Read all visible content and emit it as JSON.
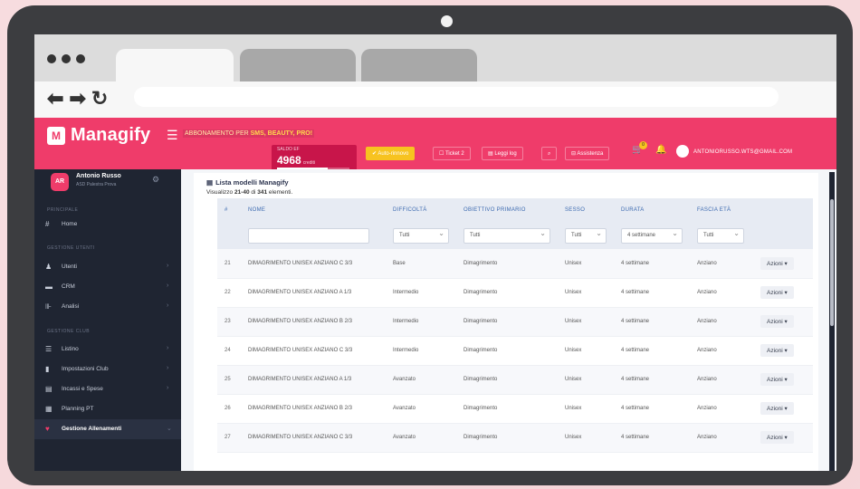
{
  "app": {
    "logo_text": "Managify",
    "marquee_prefix": "ABBONAMENTO PER ",
    "marquee_highlight": "SMS, BEAUTY, PRO!",
    "saldo_label": "SALDO EF",
    "saldo_value": "4968",
    "saldo_unit": "crediti",
    "saldo_fraction": 0.7,
    "btn_yellow": "✔ Auto-rinnovo",
    "btn_ticket": "☐ Ticket 2",
    "btn_leggi": "▤ Leggi log",
    "btn_search": "⌕",
    "btn_assistenza": "⊟ Assistenza",
    "cart_badge": "0",
    "user_email": "ANTONIORUSSO.WTS@GMAIL.COM"
  },
  "sidebar": {
    "profile_initials": "AR",
    "profile_name": "Antonio Russo",
    "profile_sub": "ASD Palestra Prova",
    "sections": [
      {
        "heading": "PRINCIPALE"
      },
      {
        "heading": "GESTIONE UTENTI"
      },
      {
        "heading": "GESTIONE CLUB"
      }
    ],
    "items": [
      {
        "label": "Home",
        "icon": "#"
      },
      {
        "label": "Utenti",
        "icon": "♟"
      },
      {
        "label": "CRM",
        "icon": "▬"
      },
      {
        "label": "Analisi",
        "icon": "⊪"
      },
      {
        "label": "Listino",
        "icon": "☰"
      },
      {
        "label": "Impostazioni Club",
        "icon": "▮"
      },
      {
        "label": "Incassi e Spese",
        "icon": "▤"
      },
      {
        "label": "Planning PT",
        "icon": "▦"
      },
      {
        "label": "Gestione Allenamenti",
        "icon": "♥"
      }
    ]
  },
  "list": {
    "title": "Lista modelli Managify",
    "summary_prefix": "Visualizzo ",
    "summary_range": "21-40",
    "summary_mid": " di ",
    "summary_total": "341",
    "summary_suffix": " elementi.",
    "columns": [
      "#",
      "NOME",
      "DIFFICOLTÀ",
      "OBIETTIVO PRIMARIO",
      "SESSO",
      "DURATA",
      "FASCIA ETÀ",
      ""
    ],
    "filters": {
      "difficolta": "Tutti",
      "obiettivo": "Tutti",
      "sesso": "Tutti",
      "durata": "4 settimane",
      "fascia": "Tutti"
    },
    "rows": [
      {
        "n": "21",
        "nome": "DIMAGRIMENTO UNISEX ANZIANO C 3/3",
        "diff": "Base",
        "obj": "Dimagrimento",
        "sesso": "Unisex",
        "durata": "4 settimane",
        "fascia": "Anziano",
        "azioni": "Azioni ▾"
      },
      {
        "n": "22",
        "nome": "DIMAGRIMENTO UNISEX ANZIANO A 1/3",
        "diff": "Intermedio",
        "obj": "Dimagrimento",
        "sesso": "Unisex",
        "durata": "4 settimane",
        "fascia": "Anziano",
        "azioni": "Azioni ▾"
      },
      {
        "n": "23",
        "nome": "DIMAGRIMENTO UNISEX ANZIANO B 2/3",
        "diff": "Intermedio",
        "obj": "Dimagrimento",
        "sesso": "Unisex",
        "durata": "4 settimane",
        "fascia": "Anziano",
        "azioni": "Azioni ▾"
      },
      {
        "n": "24",
        "nome": "DIMAGRIMENTO UNISEX ANZIANO C 3/3",
        "diff": "Intermedio",
        "obj": "Dimagrimento",
        "sesso": "Unisex",
        "durata": "4 settimane",
        "fascia": "Anziano",
        "azioni": "Azioni ▾"
      },
      {
        "n": "25",
        "nome": "DIMAGRIMENTO UNISEX ANZIANO A 1/3",
        "diff": "Avanzato",
        "obj": "Dimagrimento",
        "sesso": "Unisex",
        "durata": "4 settimane",
        "fascia": "Anziano",
        "azioni": "Azioni ▾"
      },
      {
        "n": "26",
        "nome": "DIMAGRIMENTO UNISEX ANZIANO B 2/3",
        "diff": "Avanzato",
        "obj": "Dimagrimento",
        "sesso": "Unisex",
        "durata": "4 settimane",
        "fascia": "Anziano",
        "azioni": "Azioni ▾"
      },
      {
        "n": "27",
        "nome": "DIMAGRIMENTO UNISEX ANZIANO C 3/3",
        "diff": "Avanzato",
        "obj": "Dimagrimento",
        "sesso": "Unisex",
        "durata": "4 settimane",
        "fascia": "Anziano",
        "azioni": "Azioni ▾"
      }
    ]
  },
  "colors": {
    "brand": "#ef3c6a",
    "sidebar": "#1f2532",
    "accent_yellow": "#f7c320"
  }
}
